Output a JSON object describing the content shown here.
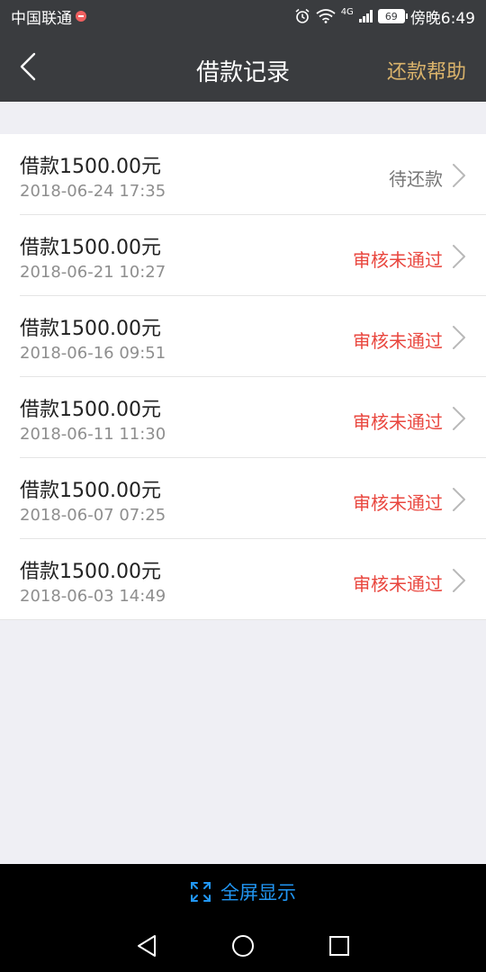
{
  "status_bar": {
    "carrier": "中国联通",
    "network": "4G",
    "battery": "69",
    "time": "傍晚6:49"
  },
  "header": {
    "title": "借款记录",
    "help_label": "还款帮助"
  },
  "colors": {
    "header_bg": "#3a3c3f",
    "help_gold": "#dab36b",
    "rejected_red": "#e9473f",
    "fullscreen_blue": "#2196f3"
  },
  "records": [
    {
      "title": "借款1500.00元",
      "time": "2018-06-24 17:35",
      "status": "待还款"
    },
    {
      "title": "借款1500.00元",
      "time": "2018-06-21 10:27",
      "status": "审核未通过"
    },
    {
      "title": "借款1500.00元",
      "time": "2018-06-16 09:51",
      "status": "审核未通过"
    },
    {
      "title": "借款1500.00元",
      "time": "2018-06-11 11:30",
      "status": "审核未通过"
    },
    {
      "title": "借款1500.00元",
      "time": "2018-06-07 07:25",
      "status": "审核未通过"
    },
    {
      "title": "借款1500.00元",
      "time": "2018-06-03 14:49",
      "status": "审核未通过"
    }
  ],
  "fullscreen": {
    "label": "全屏显示",
    "icon": "expand-icon"
  },
  "nav": {
    "back_icon": "nav-back-icon",
    "home_icon": "nav-home-icon",
    "recents_icon": "nav-recents-icon"
  }
}
